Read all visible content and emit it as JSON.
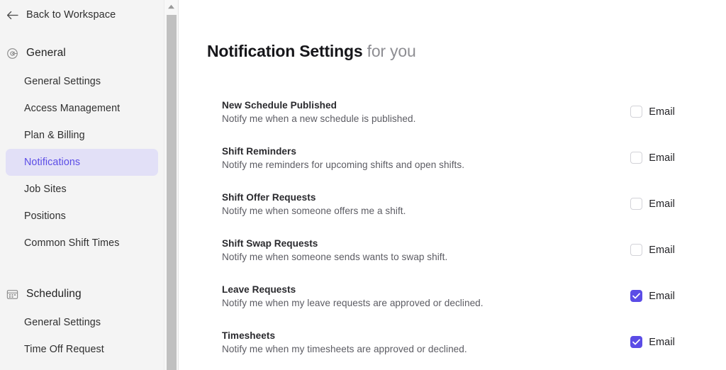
{
  "sidebar": {
    "back": {
      "label": "Back to Workspace",
      "icon": "arrow-left-icon"
    },
    "sections": [
      {
        "id": "general",
        "title": "General",
        "icon": "gear-icon",
        "items": [
          {
            "id": "general-settings",
            "label": "General Settings",
            "active": false
          },
          {
            "id": "access-management",
            "label": "Access Management",
            "active": false
          },
          {
            "id": "plan-billing",
            "label": "Plan & Billing",
            "active": false
          },
          {
            "id": "notifications",
            "label": "Notifications",
            "active": true
          },
          {
            "id": "job-sites",
            "label": "Job Sites",
            "active": false
          },
          {
            "id": "positions",
            "label": "Positions",
            "active": false
          },
          {
            "id": "common-shift-times",
            "label": "Common Shift Times",
            "active": false
          }
        ]
      },
      {
        "id": "scheduling",
        "title": "Scheduling",
        "icon": "calendar-icon",
        "items": [
          {
            "id": "scheduling-general-settings",
            "label": "General Settings",
            "active": false
          },
          {
            "id": "time-off-request",
            "label": "Time Off Request",
            "active": false
          }
        ]
      }
    ]
  },
  "main": {
    "title": "Notification Settings",
    "title_suffix": "for you",
    "channel_label": "Email",
    "rows": [
      {
        "id": "new-schedule-published",
        "title": "New Schedule Published",
        "description": "Notify me when a new schedule is published.",
        "email_checked": false
      },
      {
        "id": "shift-reminders",
        "title": "Shift Reminders",
        "description": "Notify me reminders for upcoming shifts and open shifts.",
        "email_checked": false
      },
      {
        "id": "shift-offer-requests",
        "title": "Shift Offer Requests",
        "description": "Notify me when someone offers me a shift.",
        "email_checked": false
      },
      {
        "id": "shift-swap-requests",
        "title": "Shift Swap Requests",
        "description": "Notify me when someone sends wants to swap shift.",
        "email_checked": false
      },
      {
        "id": "leave-requests",
        "title": "Leave Requests",
        "description": "Notify me when my leave requests are approved or declined.",
        "email_checked": true
      },
      {
        "id": "timesheets",
        "title": "Timesheets",
        "description": "Notify me when my timesheets are approved or declined.",
        "email_checked": true
      }
    ]
  },
  "colors": {
    "accent": "#5b4ce6",
    "active_nav_bg": "#e2e0f7",
    "sidebar_bg": "#f4f4f4",
    "scrollbar_thumb": "#c0c0c0",
    "title": "#16161a",
    "title_suffix": "#8e8e93"
  }
}
